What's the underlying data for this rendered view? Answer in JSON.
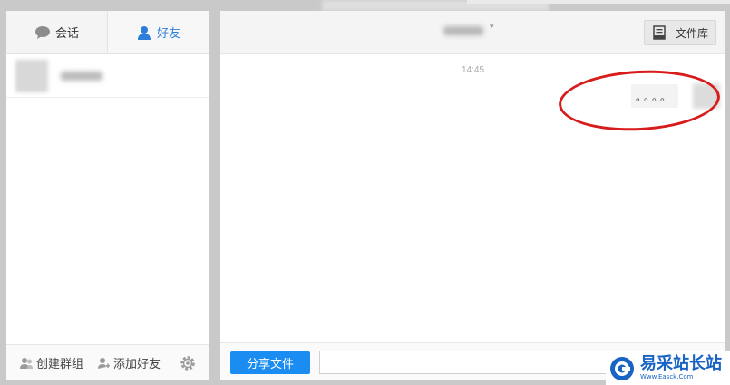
{
  "left_panel": {
    "tabs": [
      {
        "label": "会话",
        "icon": "speech-bubble-icon",
        "active": false
      },
      {
        "label": "好友",
        "icon": "person-icon",
        "active": true
      }
    ],
    "footer": {
      "create_group_label": "创建群组",
      "add_friend_label": "添加好友",
      "settings_icon": "gear-icon"
    }
  },
  "chat": {
    "file_library_label": "文件库",
    "file_library_icon": "document-icon",
    "timestamp": "14:45",
    "messages": [
      {
        "text": "。。。。",
        "from": "self"
      }
    ],
    "share_file_label": "分享文件",
    "input_value": "",
    "header_caret": "▾"
  },
  "watermark": {
    "text": "易采站长站",
    "url": "Www.Easck.Com"
  },
  "colors": {
    "accent": "#1b8cf2",
    "active_tab": "#2d7ed8",
    "annotation": "#d81b1b",
    "watermark": "#1863c4"
  }
}
